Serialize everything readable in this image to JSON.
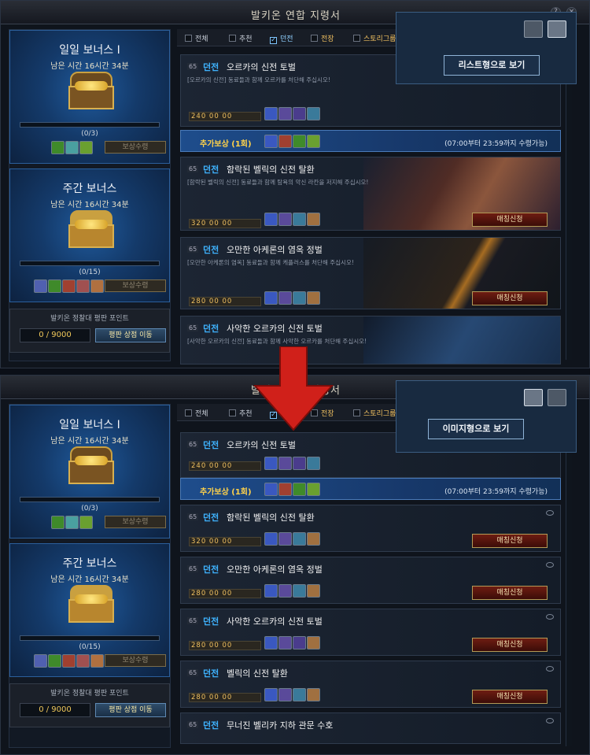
{
  "panels": [
    {
      "id": "p1",
      "title": "발키온 연합 지령서",
      "view_label": "리스트형으로 보기",
      "daily": {
        "title": "일일 보너스 Ⅰ",
        "subtitle": "남은 시간 16시간 34분",
        "count": "(0/3)",
        "receive": "보상수령"
      },
      "weekly": {
        "title": "주간 보너스",
        "subtitle": "남은 시간 16시간 34분",
        "count": "(0/15)",
        "receive": "보상수령"
      },
      "fame": {
        "title": "발키온 정찰대 평판 포인트",
        "points": "0 / 9000",
        "shop": "평판 상점 이동"
      },
      "filters": [
        "전체",
        "추천",
        "던전",
        "전장",
        "스토리그룹"
      ],
      "extra_reward": {
        "label": "추가보상 (1회)",
        "note": "(07:00부터 23:59까지 수령가능)"
      },
      "quests": [
        {
          "lvl": "65",
          "type": "던전",
          "name": "오르카의 신전 토벌",
          "desc": "[오르카의 신전] 동료들과 함께 오르카를 처단해 주십시오!",
          "cost": "240 00 00",
          "match": ""
        },
        {
          "lvl": "65",
          "type": "던전",
          "name": "함락된 벨릭의 신전 탈환",
          "desc": "[함락된 벨릭의 신전] 동료들과 함께 탐욕의 악신 라칸을 저지해 주십시오!",
          "cost": "320 00 00",
          "match": "매칭신청"
        },
        {
          "lvl": "65",
          "type": "던전",
          "name": "오만한 아케론의 염옥 정벌",
          "desc": "[오만한 아케론의 염옥] 동료들과 함께 케플러스를 처단해 주십시오!",
          "cost": "280 00 00",
          "match": "매칭신청"
        },
        {
          "lvl": "65",
          "type": "던전",
          "name": "사악한 오르카의 신전 토벌",
          "desc": "[사악한 오르카의 신전] 동료들과 함께 사악한 오르카를 처단해 주십시오!",
          "cost": "",
          "match": ""
        }
      ]
    },
    {
      "id": "p2",
      "title": "발키온 연합 지령서",
      "view_label": "이미지형으로 보기",
      "daily": {
        "title": "일일 보너스 Ⅰ",
        "subtitle": "남은 시간 16시간 34분",
        "count": "(0/3)",
        "receive": "보상수령"
      },
      "weekly": {
        "title": "주간 보너스",
        "subtitle": "남은 시간 16시간 34분",
        "count": "(0/15)",
        "receive": "보상수령"
      },
      "fame": {
        "title": "발키온 정찰대 평판 포인트",
        "points": "0 / 9000",
        "shop": "평판 상점 이동"
      },
      "filters": [
        "전체",
        "추천",
        "던전",
        "전장",
        "스토리그룹"
      ],
      "extra_reward": {
        "label": "추가보상 (1회)",
        "note": "(07:00부터 23:59까지 수령가능)"
      },
      "quests": [
        {
          "lvl": "65",
          "type": "던전",
          "name": "오르카의 신전 토벌",
          "cost": "240 00 00",
          "match": ""
        },
        {
          "lvl": "65",
          "type": "던전",
          "name": "함락된 벨릭의 신전 탈환",
          "cost": "320 00 00",
          "match": "매칭신청"
        },
        {
          "lvl": "65",
          "type": "던전",
          "name": "오만한 아케론의 염옥 정벌",
          "cost": "280 00 00",
          "match": "매칭신청"
        },
        {
          "lvl": "65",
          "type": "던전",
          "name": "사악한 오르카의 신전 토벌",
          "cost": "280 00 00",
          "match": "매칭신청"
        },
        {
          "lvl": "65",
          "type": "던전",
          "name": "벨릭의 신전 탈환",
          "cost": "280 00 00",
          "match": "매칭신청"
        },
        {
          "lvl": "65",
          "type": "던전",
          "name": "무너진 벨리카 지하 관문 수호",
          "cost": "",
          "match": ""
        }
      ]
    }
  ],
  "colors": {
    "accent": "#3fb3ff",
    "gold": "#ffd24a",
    "arrow": "#d0201a"
  }
}
